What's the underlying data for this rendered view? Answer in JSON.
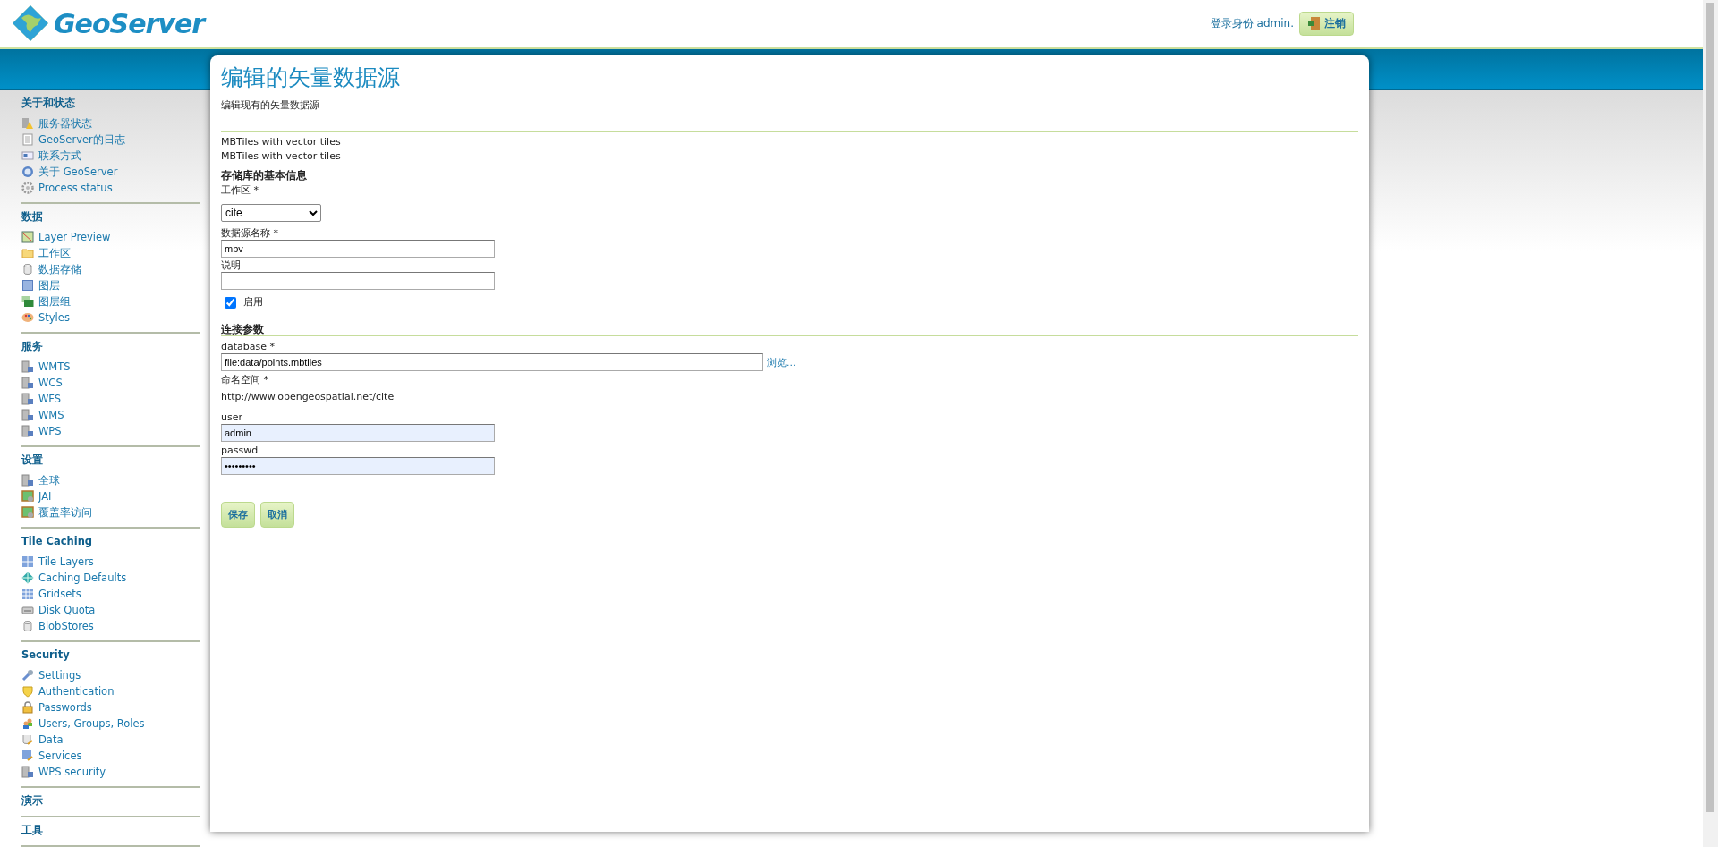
{
  "header": {
    "logo": "GeoServer",
    "login_text": "登录身份 admin.",
    "logout_button": "注销"
  },
  "sidebar": [
    {
      "title": "关于和状态",
      "items": [
        "服务器状态",
        "GeoServer的日志",
        "联系方式",
        "关于 GeoServer",
        "Process status"
      ]
    },
    {
      "title": "数据",
      "items": [
        "Layer Preview",
        "工作区",
        "数据存储",
        "图层",
        "图层组",
        "Styles"
      ]
    },
    {
      "title": "服务",
      "items": [
        "WMTS",
        "WCS",
        "WFS",
        "WMS",
        "WPS"
      ]
    },
    {
      "title": "设置",
      "items": [
        "全球",
        "JAI",
        "覆盖率访问"
      ]
    },
    {
      "title": "Tile Caching",
      "items": [
        "Tile Layers",
        "Caching Defaults",
        "Gridsets",
        "Disk Quota",
        "BlobStores"
      ]
    },
    {
      "title": "Security",
      "items": [
        "Settings",
        "Authentication",
        "Passwords",
        "Users, Groups, Roles",
        "Data",
        "Services",
        "WPS security"
      ]
    },
    {
      "title": "演示"
    },
    {
      "title": "工具"
    }
  ],
  "page": {
    "title": "编辑的矢量数据源",
    "description": "编辑现有的矢量数据源",
    "store_type": "MBTiles with vector tiles",
    "store_description": "MBTiles with vector tiles",
    "basic_section": {
      "heading": "存储库的基本信息",
      "workspace": {
        "label": "工作区 *",
        "value": "cite"
      },
      "name": {
        "label": "数据源名称 *",
        "value": "mbv"
      },
      "description": {
        "label": "说明"
      },
      "enabled": {
        "label": "启用",
        "checked": true
      }
    },
    "connection_section": {
      "heading": "连接参数",
      "fields": [
        {
          "kind": "file",
          "label": "database *",
          "value": "file:data/points.mbtiles",
          "browse": "浏览..."
        },
        {
          "kind": "text",
          "label": "命名空间 *",
          "value": "http://www.opengeospatial.net/cite"
        },
        {
          "kind": "input",
          "label": "user",
          "value": "admin"
        },
        {
          "kind": "input",
          "label": "passwd",
          "value": "•••••••••"
        }
      ]
    },
    "buttons": [
      "保存",
      "取消"
    ]
  }
}
